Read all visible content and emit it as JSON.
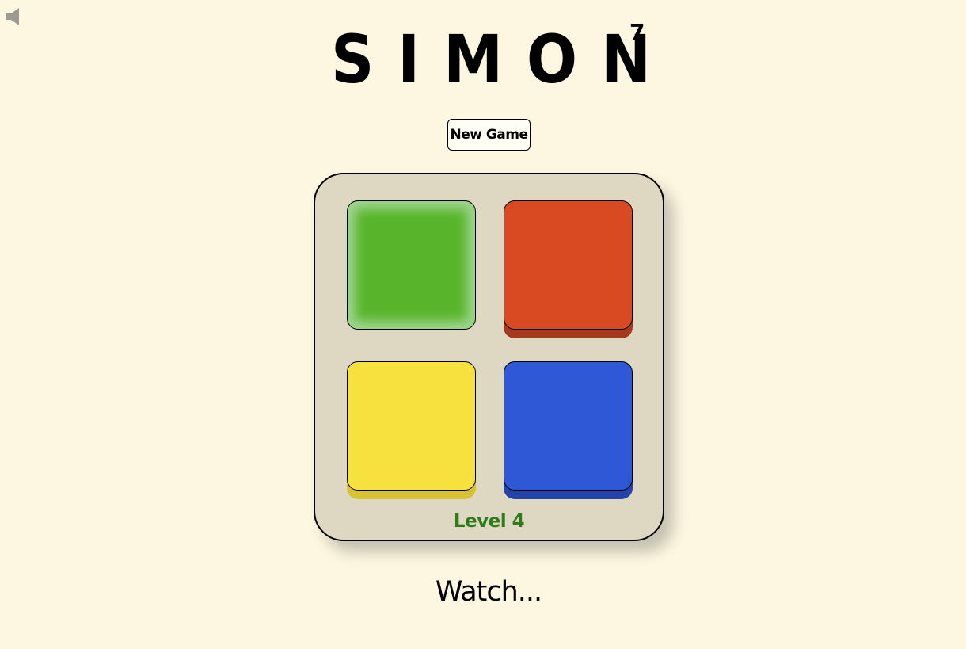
{
  "sound_toggle": {
    "icon": "speaker-icon",
    "color": "#9c9a8e"
  },
  "title": {
    "text": "SIMON",
    "superscript": "7"
  },
  "new_game_label": "New Game",
  "board": {
    "pads": [
      {
        "color_name": "green",
        "face_color": "#58b52b",
        "state": "lit"
      },
      {
        "color_name": "red",
        "face_color": "#d94a22",
        "state": "idle"
      },
      {
        "color_name": "yellow",
        "face_color": "#f7e13e",
        "state": "idle"
      },
      {
        "color_name": "blue",
        "face_color": "#2f58d6",
        "state": "idle"
      }
    ],
    "level_text": "Level 4",
    "level_color": "#2f7a19"
  },
  "status_text": "Watch..."
}
